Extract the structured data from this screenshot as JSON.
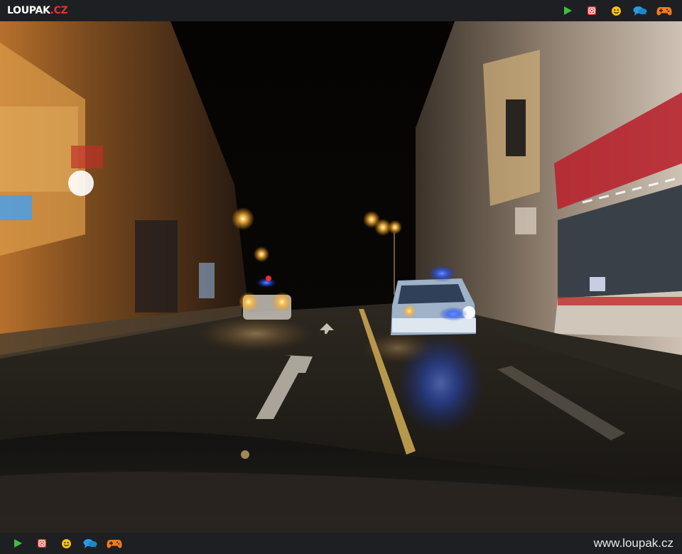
{
  "header": {
    "logo_main": "LOUPAK",
    "logo_tld": ".CZ",
    "icons": [
      "play-icon",
      "instagram-icon",
      "smiley-icon",
      "chat-icon",
      "gamepad-icon"
    ]
  },
  "footer": {
    "url": "www.loupak.cz",
    "icons": [
      "play-icon",
      "instagram-icon",
      "smiley-icon",
      "chat-icon",
      "gamepad-icon"
    ]
  },
  "photo": {
    "subject": "night street chase with police cars, motion blur, dashboard in foreground"
  },
  "colors": {
    "bar_bg": "#1e1f22",
    "brand_red": "#e4342a",
    "play_green": "#3fbf3f",
    "smiley_yellow": "#f2c21b",
    "chat_blue": "#2b9be0",
    "gamepad_orange": "#f07a1c",
    "police_blue": "#2a5cff"
  }
}
